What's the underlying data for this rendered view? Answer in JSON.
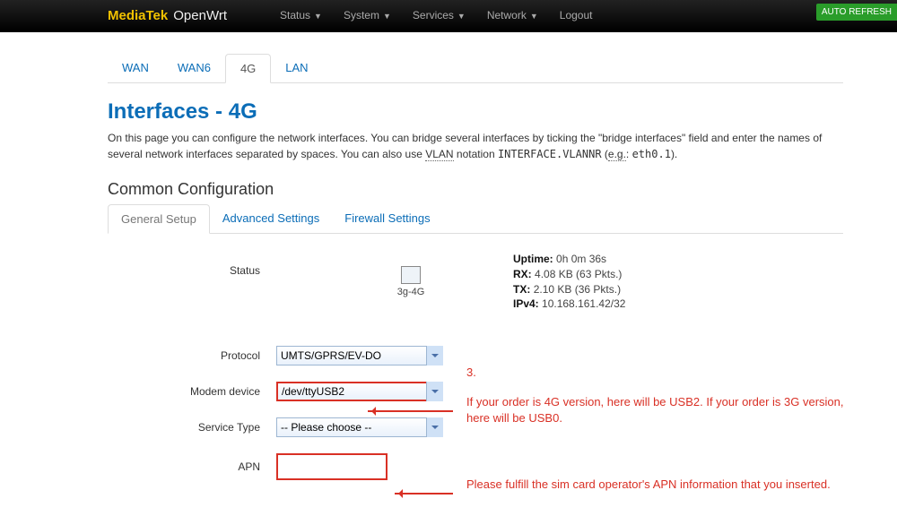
{
  "topbar": {
    "brand_a": "MediaTek",
    "brand_b": "OpenWrt",
    "items": [
      "Status",
      "System",
      "Services",
      "Network",
      "Logout"
    ],
    "auto": "AUTO REFRESH"
  },
  "tabs": {
    "items": [
      "WAN",
      "WAN6",
      "4G",
      "LAN"
    ],
    "active": 2
  },
  "title": "Interfaces - 4G",
  "desc_a": "On this page you can configure the network interfaces. You can bridge several interfaces by ticking the \"bridge interfaces\" field and enter the names of several network interfaces separated by spaces. You can also use ",
  "desc_vlan": "VLAN",
  "desc_b": " notation ",
  "desc_code": "INTERFACE.VLANNR",
  "desc_c": " (",
  "desc_eg": "e.g.",
  "desc_d": ": ",
  "desc_code2": "eth0.1",
  "desc_e": ").",
  "section": "Common Configuration",
  "subtabs": {
    "items": [
      "General Setup",
      "Advanced Settings",
      "Firewall Settings"
    ],
    "active": 0
  },
  "status_label": "Status",
  "iface_name": "3g-4G",
  "stats": {
    "uptime_l": "Uptime:",
    "uptime": "0h 0m 36s",
    "rx_l": "RX:",
    "rx": "4.08 KB (63 Pkts.)",
    "tx_l": "TX:",
    "tx": "2.10 KB (36 Pkts.)",
    "ip_l": "IPv4:",
    "ip": "10.168.161.42/32"
  },
  "fields": {
    "protocol_l": "Protocol",
    "protocol_v": "UMTS/GPRS/EV-DO",
    "modem_l": "Modem device",
    "modem_v": "/dev/ttyUSB2",
    "service_l": "Service Type",
    "service_v": "-- Please choose --",
    "apn_l": "APN",
    "apn_v": ""
  },
  "ann": {
    "num": "3.",
    "usb": "If your order is 4G version, here will be USB2. If your order is 3G version, here will be USB0.",
    "apn": "Please fulfill the sim card operator's APN information that you inserted."
  }
}
